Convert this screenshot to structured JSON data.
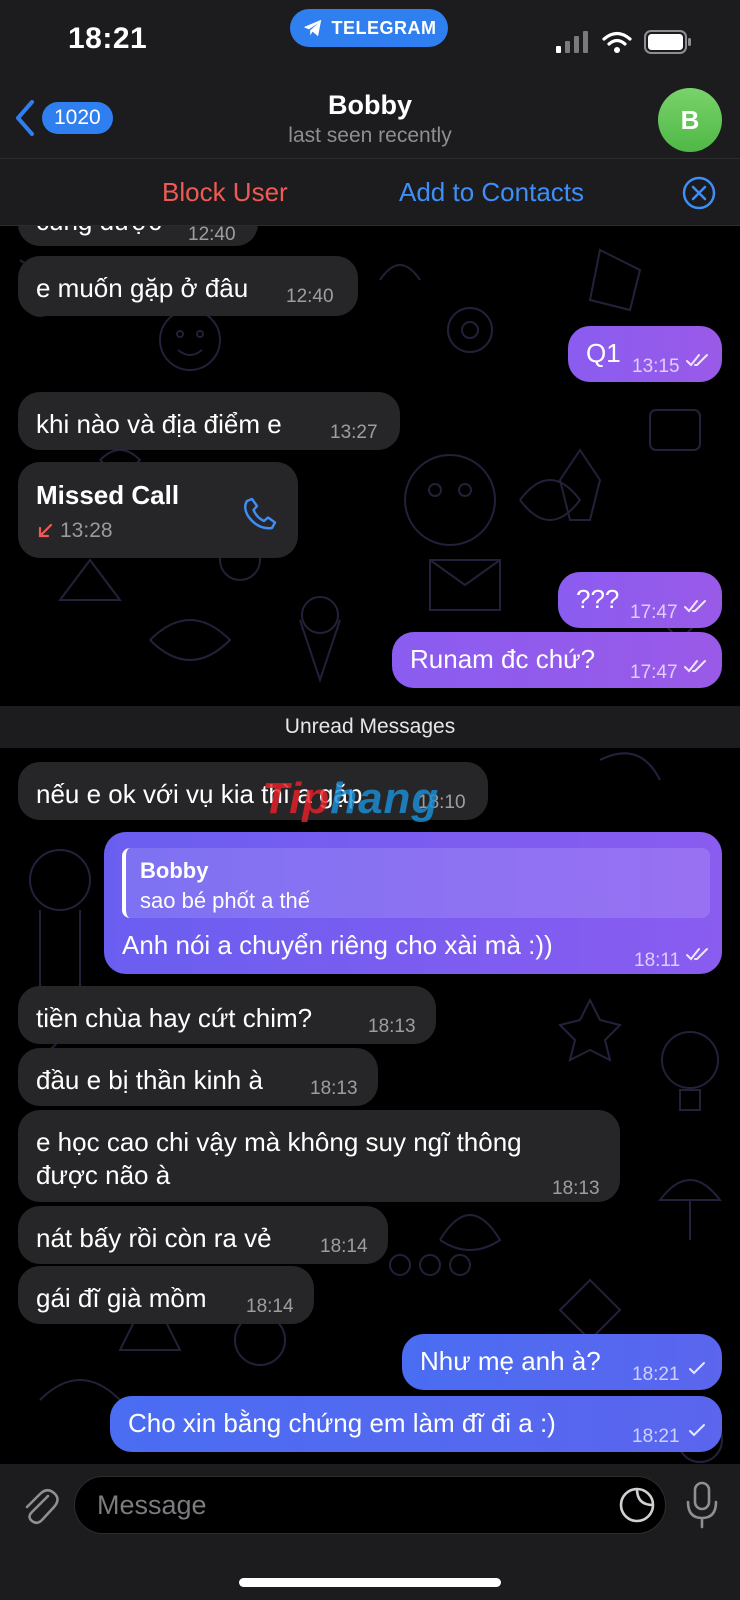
{
  "status_bar": {
    "time": "18:21",
    "app_pill": "TELEGRAM"
  },
  "header": {
    "back_count": "1020",
    "title": "Bobby",
    "subtitle": "last seen recently",
    "avatar_initial": "B"
  },
  "banner": {
    "block_label": "Block User",
    "add_label": "Add to Contacts"
  },
  "messages": {
    "m0": {
      "text": "cũng được",
      "time": "12:40"
    },
    "m1": {
      "text": "e muốn gặp ở đâu",
      "time": "12:40"
    },
    "m2": {
      "text": "Q1",
      "time": "13:15"
    },
    "m3": {
      "text": "khi nào và địa điểm e",
      "time": "13:27"
    },
    "m4": {
      "title": "Missed Call",
      "time": "13:28"
    },
    "m5": {
      "text": "???",
      "time": "17:47"
    },
    "m6": {
      "text": "Runam đc chứ?",
      "time": "17:47"
    },
    "m7": {
      "text": "nếu e ok với vụ kia thì a gặp",
      "time": "18:10"
    },
    "m8": {
      "reply_author": "Bobby",
      "reply_text": "sao bé phốt a thế",
      "text": "Anh nói a chuyển riêng cho xài mà :))",
      "time": "18:11"
    },
    "m9": {
      "text": "tiền chùa hay cứt chim?",
      "time": "18:13"
    },
    "m10": {
      "text": "đầu e bị thần kinh à",
      "time": "18:13"
    },
    "m11": {
      "line1": "e học cao chi vậy mà không suy ngĩ thông",
      "line2": "được não à",
      "time": "18:13"
    },
    "m12": {
      "text": "nát bấy rồi còn ra vẻ",
      "time": "18:14"
    },
    "m13": {
      "text": "gái đĩ già mồm",
      "time": "18:14"
    },
    "m14": {
      "text": "Như mẹ anh à?",
      "time": "18:21"
    },
    "m15": {
      "text": "Cho xin bằng chứng em làm đĩ đi a :)",
      "time": "18:21"
    }
  },
  "unread_label": "Unread Messages",
  "watermark": {
    "part1": "Tip",
    "part2": "hang"
  },
  "composer": {
    "placeholder": "Message"
  },
  "colors": {
    "accent": "#2f7ff0",
    "danger": "#f05a55",
    "incoming_bubble": "#262628",
    "outgoing_bubble": "#6a60f0"
  },
  "icons": [
    "telegram-icon",
    "signal-icon",
    "wifi-icon",
    "battery-icon",
    "chevron-left-icon",
    "close-circle-icon",
    "missed-call-arrow-icon",
    "phone-icon",
    "double-check-icon",
    "single-check-icon",
    "paperclip-icon",
    "sticker-icon",
    "microphone-icon"
  ]
}
